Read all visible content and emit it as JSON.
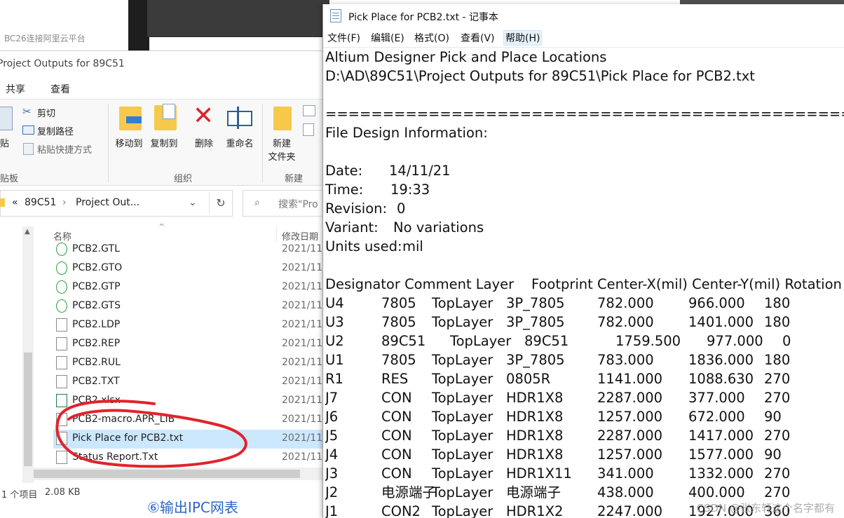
{
  "background": {
    "sidebar_text": "BC26连接阿里云平台",
    "annotation": "⑥输出IPC网表"
  },
  "explorer": {
    "title": "Project Outputs for 89C51",
    "tabs": [
      "共享",
      "查看"
    ],
    "ribbon": {
      "clipboard": {
        "paste_label": "贴",
        "cut": "剪切",
        "copy_path": "复制路径",
        "paste_shortcut": "粘贴快捷方式",
        "group": "贴板"
      },
      "organize": {
        "move_to": "移动到",
        "copy_to": "复制到",
        "delete": "删除",
        "rename": "重命名",
        "group": "组织"
      },
      "new": {
        "new_folder_1": "新建",
        "new_folder_2": "文件夹",
        "group": "新建"
      }
    },
    "address": {
      "prefix": "«",
      "segment1": "89C51",
      "sep": "›",
      "segment2": "Project Out..."
    },
    "search": {
      "placeholder": "搜索\"Pro"
    },
    "columns": {
      "name": "名称",
      "date": "修改日期"
    },
    "files": [
      {
        "name": "PCB2.GTL",
        "date": "2021/11",
        "icon": "gerber-icon"
      },
      {
        "name": "PCB2.GTO",
        "date": "2021/11",
        "icon": "gerber-icon"
      },
      {
        "name": "PCB2.GTP",
        "date": "2021/11",
        "icon": "gerber-icon"
      },
      {
        "name": "PCB2.GTS",
        "date": "2021/11",
        "icon": "gerber-icon"
      },
      {
        "name": "PCB2.LDP",
        "date": "2021/11",
        "icon": "file-icon"
      },
      {
        "name": "PCB2.REP",
        "date": "2021/11",
        "icon": "text-file-icon"
      },
      {
        "name": "PCB2.RUL",
        "date": "2021/11",
        "icon": "file-icon"
      },
      {
        "name": "PCB2.TXT",
        "date": "2021/11",
        "icon": "text-file-icon"
      },
      {
        "name": "PCB2.xlsx",
        "date": "2021/11",
        "icon": "excel-icon"
      },
      {
        "name": "PCB2-macro.APR_LIB",
        "date": "2021/11",
        "icon": "file-icon"
      },
      {
        "name": "Pick Place for PCB2.txt",
        "date": "2021/11",
        "icon": "text-file-icon",
        "selected": true
      },
      {
        "name": "Status Report.Txt",
        "date": "2021/11",
        "icon": "text-file-icon"
      }
    ],
    "status": {
      "selected": "1 个项目",
      "size": "2.08 KB"
    }
  },
  "notepad": {
    "title": "Pick Place for PCB2.txt - 记事本",
    "menu": [
      "文件(F)",
      "编辑(E)",
      "格式(O)",
      "查看(V)",
      "帮助(H)"
    ],
    "header_lines": [
      "Altium Designer Pick and Place Locations",
      "D:\\AD\\89C51\\Project Outputs for 89C51\\Pick Place for PCB2.txt",
      "",
      "==========================================================",
      "File Design Information:"
    ],
    "info": {
      "date_label": "Date:",
      "date": "14/11/21",
      "time_label": "Time:",
      "time": "19:33",
      "revision_label": "Revision:",
      "revision": "0",
      "variant_label": "Variant:",
      "variant": "No variations",
      "units_label": "Units used:",
      "units": "mil"
    },
    "table_header": "Designator Comment Layer    Footprint Center-X(mil) Center-Y(mil) Rotation",
    "rows": [
      [
        "U4",
        "7805",
        "TopLayer",
        "3P_7805",
        "782.000",
        "966.000",
        "180"
      ],
      [
        "U3",
        "7805",
        "TopLayer",
        "3P_7805",
        "782.000",
        "1401.000",
        "180"
      ],
      [
        "U2",
        "89C51",
        "TopLayer",
        "89C51",
        "1759.500",
        "977.000",
        "0"
      ],
      [
        "U1",
        "7805",
        "TopLayer",
        "3P_7805",
        "783.000",
        "1836.000",
        "180"
      ],
      [
        "R1",
        "RES",
        "TopLayer",
        "0805R",
        "1141.000",
        "1088.630",
        "270"
      ],
      [
        "J7",
        "CON",
        "TopLayer",
        "HDR1X8",
        "2287.000",
        "377.000",
        "270"
      ],
      [
        "J6",
        "CON",
        "TopLayer",
        "HDR1X8",
        "1257.000",
        "672.000",
        "90"
      ],
      [
        "J5",
        "CON",
        "TopLayer",
        "HDR1X8",
        "2287.000",
        "1417.000",
        "270"
      ],
      [
        "J4",
        "CON",
        "TopLayer",
        "HDR1X8",
        "1257.000",
        "1577.000",
        "90"
      ],
      [
        "J3",
        "CON",
        "TopLayer",
        "HDR1X11",
        "341.000",
        "1332.000",
        "270"
      ],
      [
        "J2",
        "电源端子",
        "TopLayer",
        "电源端子",
        "438.000",
        "400.000",
        "270"
      ],
      [
        "J1",
        "CON2",
        "TopLayer",
        "HDR1X2",
        "2247.000",
        "1927.000",
        "360"
      ]
    ],
    "watermark": "CSDN @张东轩这个名字都有"
  }
}
